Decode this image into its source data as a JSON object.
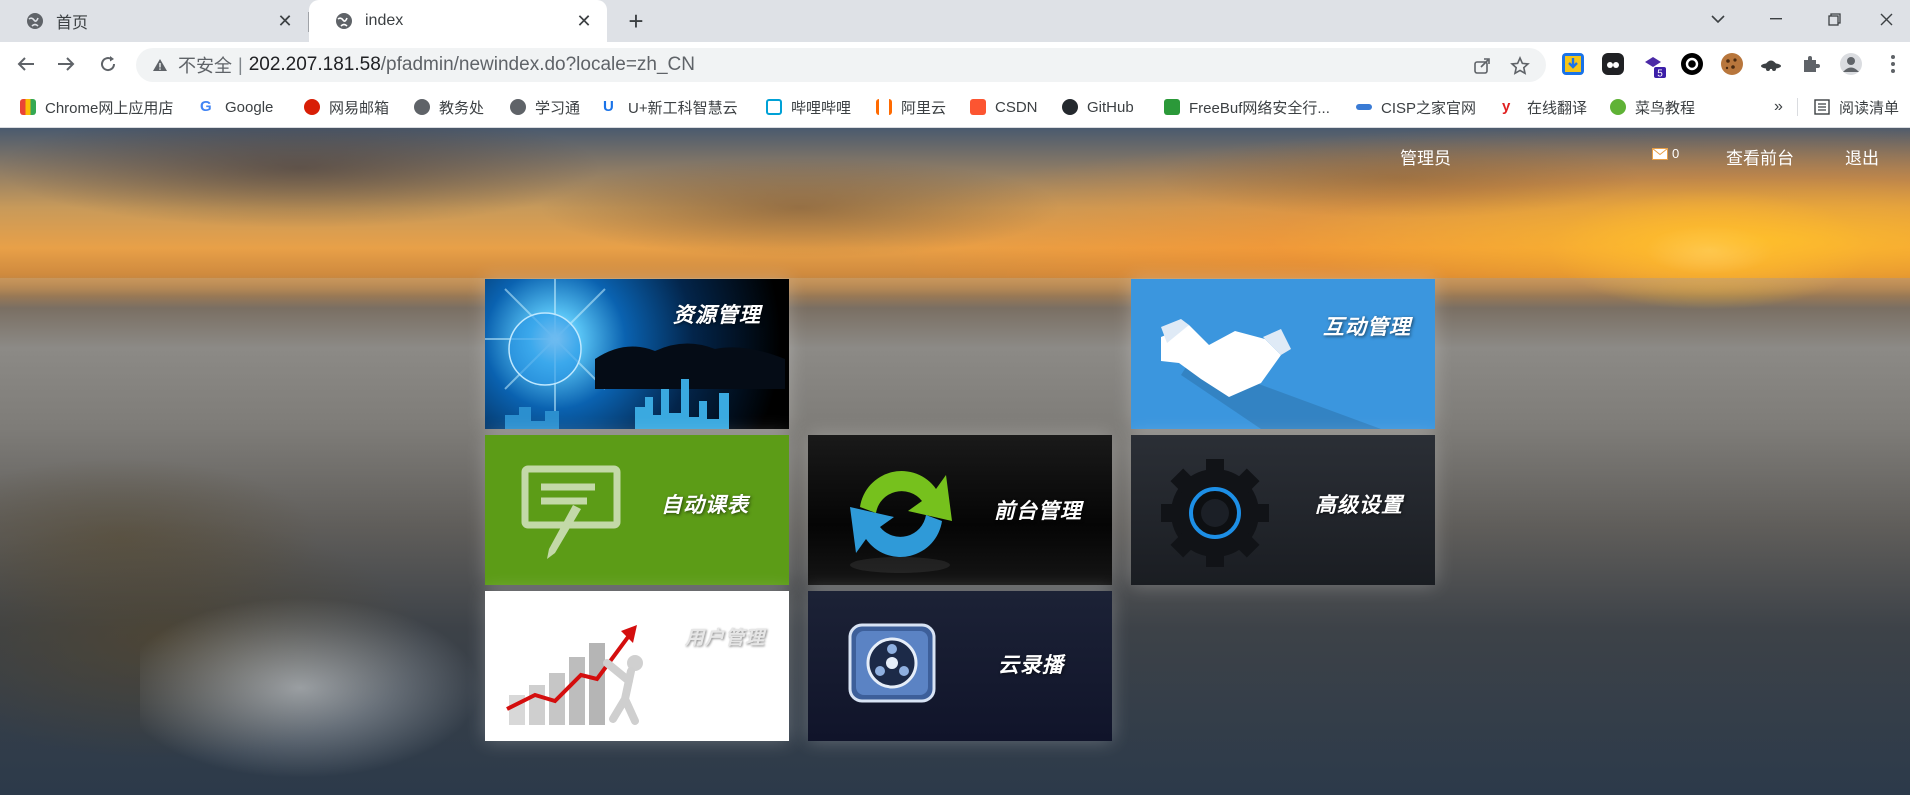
{
  "browser": {
    "tabs": [
      {
        "title": "首页",
        "active": false
      },
      {
        "title": "index",
        "active": true
      }
    ],
    "new_tab_symbol": "+",
    "close_symbol": "✕",
    "window_controls": [
      "chevron-down",
      "minimize",
      "restore",
      "close"
    ],
    "address": {
      "security_label": "不安全",
      "host": "202.207.181.58",
      "path": "/pfadmin/newindex.do?locale=zh_CN"
    },
    "extension_badge": "5",
    "bookmarks": [
      {
        "label": "Chrome网上应用店",
        "icon_color": "#34a853"
      },
      {
        "label": "Google",
        "icon_color": "#4285f4"
      },
      {
        "label": "网易邮箱",
        "icon_color": "#d81e06"
      },
      {
        "label": "教务处",
        "icon_color": "#5f6368"
      },
      {
        "label": "学习通",
        "icon_color": "#5f6368"
      },
      {
        "label": "U+新工科智慧云",
        "icon_color": "#1a73e8"
      },
      {
        "label": "哔哩哔哩",
        "icon_color": "#00a1d6"
      },
      {
        "label": "阿里云",
        "icon_color": "#ff6a00"
      },
      {
        "label": "CSDN",
        "icon_color": "#fc5531"
      },
      {
        "label": "GitHub",
        "icon_color": "#24292e"
      },
      {
        "label": "FreeBuf网络安全行...",
        "icon_color": "#2b9939"
      },
      {
        "label": "CISP之家官网",
        "icon_color": "#3a7bd5"
      },
      {
        "label": "在线翻译",
        "icon_color": "#e02020"
      },
      {
        "label": "菜鸟教程",
        "icon_color": "#5fb236"
      }
    ],
    "bookmarks_overflow": "»",
    "reading_list": "阅读清单"
  },
  "header": {
    "admin_label": "管理员",
    "mail_count": "0",
    "view_front_label": "查看前台",
    "logout_label": "退出"
  },
  "tiles": {
    "resource": "资源管理",
    "interaction": "互动管理",
    "schedule": "自动课表",
    "frontend": "前台管理",
    "advanced": "高级设置",
    "user": "用户管理",
    "cloud": "云录播"
  },
  "colors": {
    "tile_interaction": "#3b96de",
    "tile_schedule": "#5c9c17",
    "tile_advanced": "#1f2228",
    "tile_cloud": "#141a30"
  }
}
